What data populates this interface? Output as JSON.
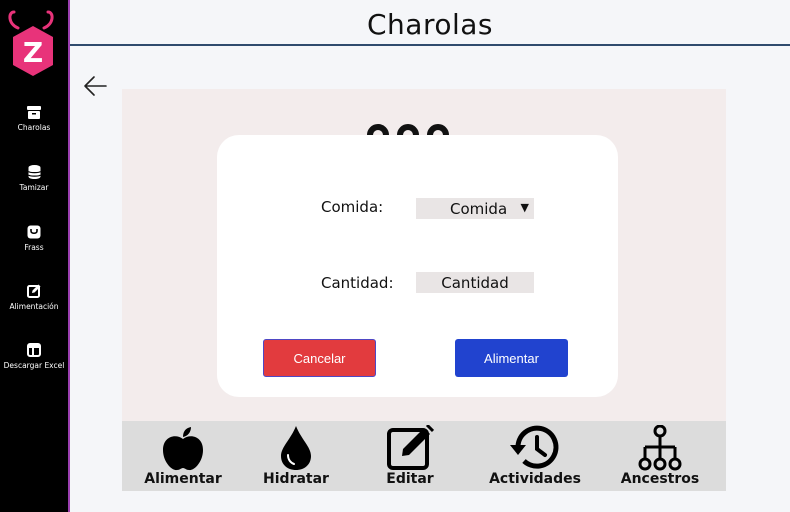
{
  "header": {
    "title": "Charolas"
  },
  "sidebar": {
    "items": [
      {
        "label": "Charolas",
        "icon": "archive-icon"
      },
      {
        "label": "Tamizar",
        "icon": "database-icon"
      },
      {
        "label": "Frass",
        "icon": "bag-icon"
      },
      {
        "label": "Alimentación",
        "icon": "edit-square-icon"
      },
      {
        "label": "Descargar Excel",
        "icon": "table-icon"
      }
    ]
  },
  "modal": {
    "food_label": "Comida:",
    "food_select_value": "Comida",
    "quantity_label": "Cantidad:",
    "quantity_placeholder": "Cantidad",
    "cancel_label": "Cancelar",
    "feed_label": "Alimentar"
  },
  "toolbar": {
    "items": [
      {
        "label": "Alimentar",
        "icon": "apple-icon"
      },
      {
        "label": "Hidratar",
        "icon": "water-drop-icon"
      },
      {
        "label": "Editar",
        "icon": "edit-icon"
      },
      {
        "label": "Actividades",
        "icon": "history-icon"
      },
      {
        "label": "Ancestros",
        "icon": "hierarchy-icon"
      }
    ]
  },
  "colors": {
    "sidebar_bg": "#000000",
    "brand_pink": "#e8337a",
    "cancel_red": "#e23b3e",
    "primary_blue": "#2143cf",
    "panel_bg": "#f3ecec",
    "toolbar_bg": "#dcdcdc"
  }
}
